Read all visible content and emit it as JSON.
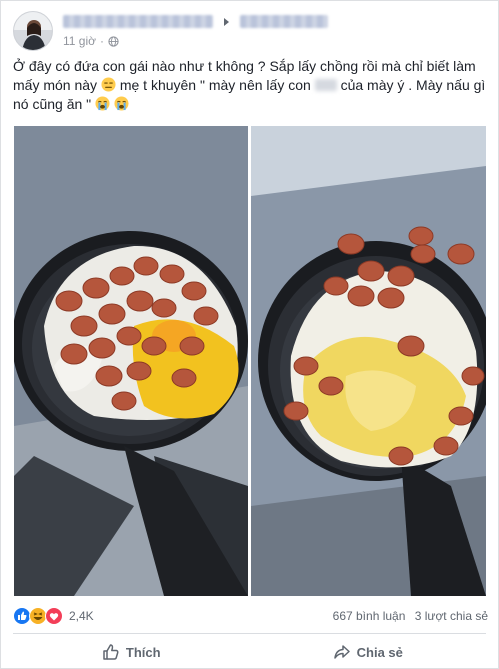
{
  "post": {
    "time": "11 giờ",
    "text": {
      "part1": "Ở đây có đứa con gái nào như t không ? Sắp lấy chồng rồi mà chỉ biết làm mấy món này ",
      "part2": " mẹ t khuyên \" mày nên lấy con ",
      "part3": " của mày ý . Mày nấu gì nó cũng ăn \" "
    },
    "icons": {
      "privacy": "globe-icon",
      "audience_caret": "caret-right-icon",
      "emoji_1": "expressionless-face-icon",
      "emoji_2": "loudly-crying-face-icon",
      "like": "like-thumb-icon",
      "share": "share-arrow-icon"
    },
    "photos": [
      {
        "name": "fried-sausage-egg-photo-1"
      },
      {
        "name": "fried-sausage-egg-photo-2"
      }
    ]
  },
  "stats": {
    "reaction_count": "2,4K",
    "reactions": [
      "like",
      "haha",
      "love"
    ],
    "comments": "667 bình luận",
    "shares": "3 lượt chia sẻ"
  },
  "actions": {
    "like_label": "Thích",
    "share_label": "Chia sẻ"
  },
  "colors": {
    "like_blue": "#1877f2",
    "haha_yellow": "#f7b125",
    "love_red": "#f33e58",
    "muted_text": "#606770"
  }
}
